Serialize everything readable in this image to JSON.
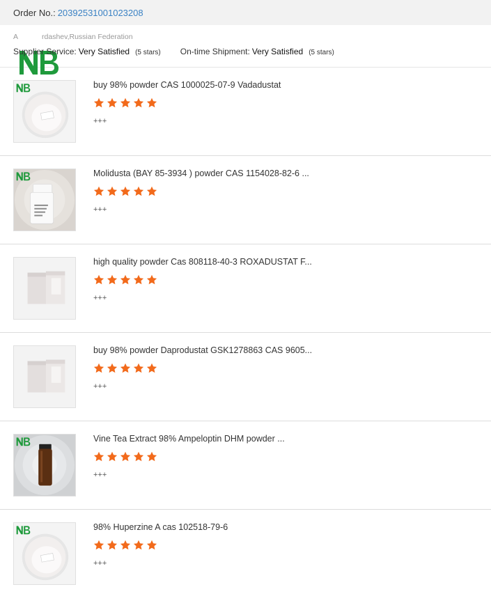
{
  "order": {
    "label": "Order No.:",
    "number": "20392531001023208"
  },
  "buyer": {
    "address_prefix": "A",
    "address_rest": "rdashev,Russian Federation"
  },
  "ratings": {
    "service_label": "Supplier Service:",
    "service_value": "Very Satisfied",
    "service_stars": "(5 stars)",
    "shipment_label": "On-time Shipment:",
    "shipment_value": "Very Satisfied",
    "shipment_stars": "(5 stars)"
  },
  "colors": {
    "logo_green": "#1f9a3c",
    "star_orange": "#f26a1b",
    "link_blue": "#3b82c4"
  },
  "products": [
    {
      "title": "buy 98% powder CAS 1000025-07-9 Vadadustat",
      "stars": 5,
      "review": "+++",
      "image": "powder-plate"
    },
    {
      "title": "Molidusta (BAY 85-3934 ) powder CAS 1154028-82-6 ...",
      "stars": 5,
      "review": "+++",
      "image": "white-bottle"
    },
    {
      "title": "high quality powder Cas 808118-40-3 ROXADUSTAT F...",
      "stars": 5,
      "review": "+++",
      "image": "foil-bags"
    },
    {
      "title": "buy 98% powder Daprodustat GSK1278863 CAS 9605...",
      "stars": 5,
      "review": "+++",
      "image": "foil-bags"
    },
    {
      "title": "Vine Tea Extract 98% Ampeloptin DHM powder ...",
      "stars": 5,
      "review": "+++",
      "image": "amber-vial"
    },
    {
      "title": "98% Huperzine A cas 102518-79-6",
      "stars": 5,
      "review": "+++",
      "image": "powder-plate"
    }
  ]
}
